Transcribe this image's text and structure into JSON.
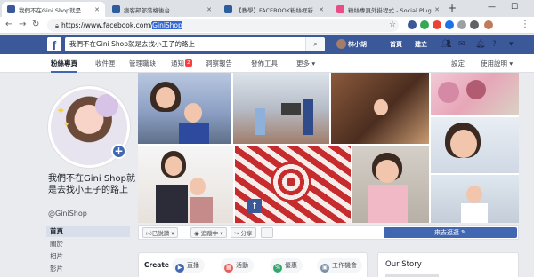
{
  "browser": {
    "tabs": [
      {
        "label": "我們不在Gini Shop就是去找小王",
        "favicon_color": "#3b5998",
        "active": true
      },
      {
        "label": "痞客邦部落格後台",
        "favicon_color": "#2c5d9e",
        "active": false
      },
      {
        "label": "【教學】FACEBOOK粉絲框新",
        "favicon_color": "#2c5d9e",
        "active": false
      },
      {
        "label": "粉絲專頁外掛程式 - Social Plug",
        "favicon_color": "#e94c89",
        "active": false
      }
    ],
    "new_tab": "+",
    "window_controls": {
      "minimize": "—",
      "maximize": "☐"
    },
    "url_prefix": "https://www.facebook.com/",
    "url_selected": "GiniShop"
  },
  "fb_header": {
    "logo": "f",
    "search_value": "我們不在Gini Shop就是去找小王子的路上",
    "user_name": "林小胡",
    "nav": [
      "首頁",
      "建立"
    ]
  },
  "page_tabs": {
    "left": [
      {
        "label": "粉絲專頁",
        "active": true
      },
      {
        "label": "收件匣",
        "active": false
      },
      {
        "label": "管理職缺",
        "active": false
      },
      {
        "label": "通知",
        "active": false,
        "badge": "2"
      },
      {
        "label": "洞察報告",
        "active": false
      },
      {
        "label": "發佈工具",
        "active": false
      },
      {
        "label": "更多 ▾",
        "active": false
      }
    ],
    "right": [
      "設定",
      "使用說明 ▾"
    ]
  },
  "profile": {
    "name": "我們不在Gini Shop就是去找小王子的路上",
    "handle": "@GiniShop",
    "add_icon": "+"
  },
  "left_nav": [
    {
      "label": "首頁",
      "active": true
    },
    {
      "label": "關於",
      "active": false
    },
    {
      "label": "相片",
      "active": false
    },
    {
      "label": "影片",
      "active": false
    }
  ],
  "action_bar": {
    "liked": "已說讚 ▾",
    "following": "追蹤中 ▾",
    "share": "分享",
    "more": "···",
    "contact": "來去逛逛 ✎"
  },
  "create": {
    "title": "Create",
    "items": [
      {
        "label": "直播",
        "icon_color": "#4267b2"
      },
      {
        "label": "活動",
        "icon_color": "#e4605e"
      },
      {
        "label": "優惠",
        "icon_color": "#35a66b"
      },
      {
        "label": "工作機會",
        "icon_color": "#7d8ea6"
      }
    ]
  },
  "story": {
    "title": "Our Story"
  }
}
